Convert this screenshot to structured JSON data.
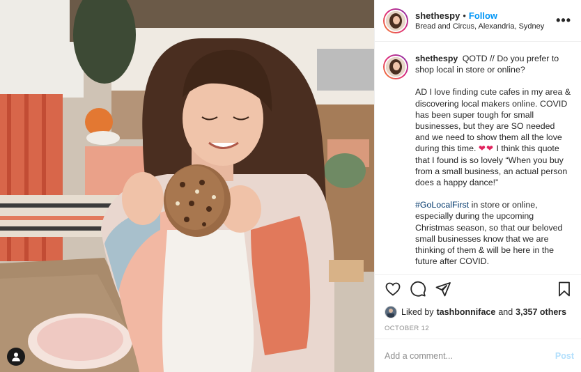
{
  "post": {
    "username": "shethespy",
    "follow_separator": "•",
    "follow_label": "Follow",
    "location": "Bread and Circus, Alexandria, Sydney",
    "more_label": "•••"
  },
  "caption": {
    "username": "shethespy",
    "p1": "QOTD // Do you prefer to shop local in store or online?",
    "p2_a": "AD I love finding cute cafes in my area & discovering local makers online. COVID has been super tough for small businesses, but they are SO needed and we need to show them all the love during this time.",
    "p2_hearts": "❤❤",
    "p2_b": "I think this quote that I found is so lovely “When you buy from a small business, an actual person does a happy dance!”",
    "p3_hashtag": "#GoLocalFirst",
    "p3_text": "in store or online, especially during the upcoming Christmas season, so that our beloved small businesses know that we are thinking of them & will be here in the future after COVID."
  },
  "actions": {
    "like_icon": "heart-icon",
    "comment_icon": "comment-icon",
    "share_icon": "share-icon",
    "save_icon": "bookmark-icon"
  },
  "likes": {
    "prefix": "Liked by",
    "liker": "tashbonniface",
    "and": "and",
    "others": "3,357 others"
  },
  "date": "OCTOBER 12",
  "comment": {
    "placeholder": "Add a comment...",
    "post_label": "Post"
  },
  "colors": {
    "follow": "#0095f6",
    "hashtag": "#00376b",
    "post_disabled": "#b2dffc",
    "heart": "#e0245e"
  }
}
